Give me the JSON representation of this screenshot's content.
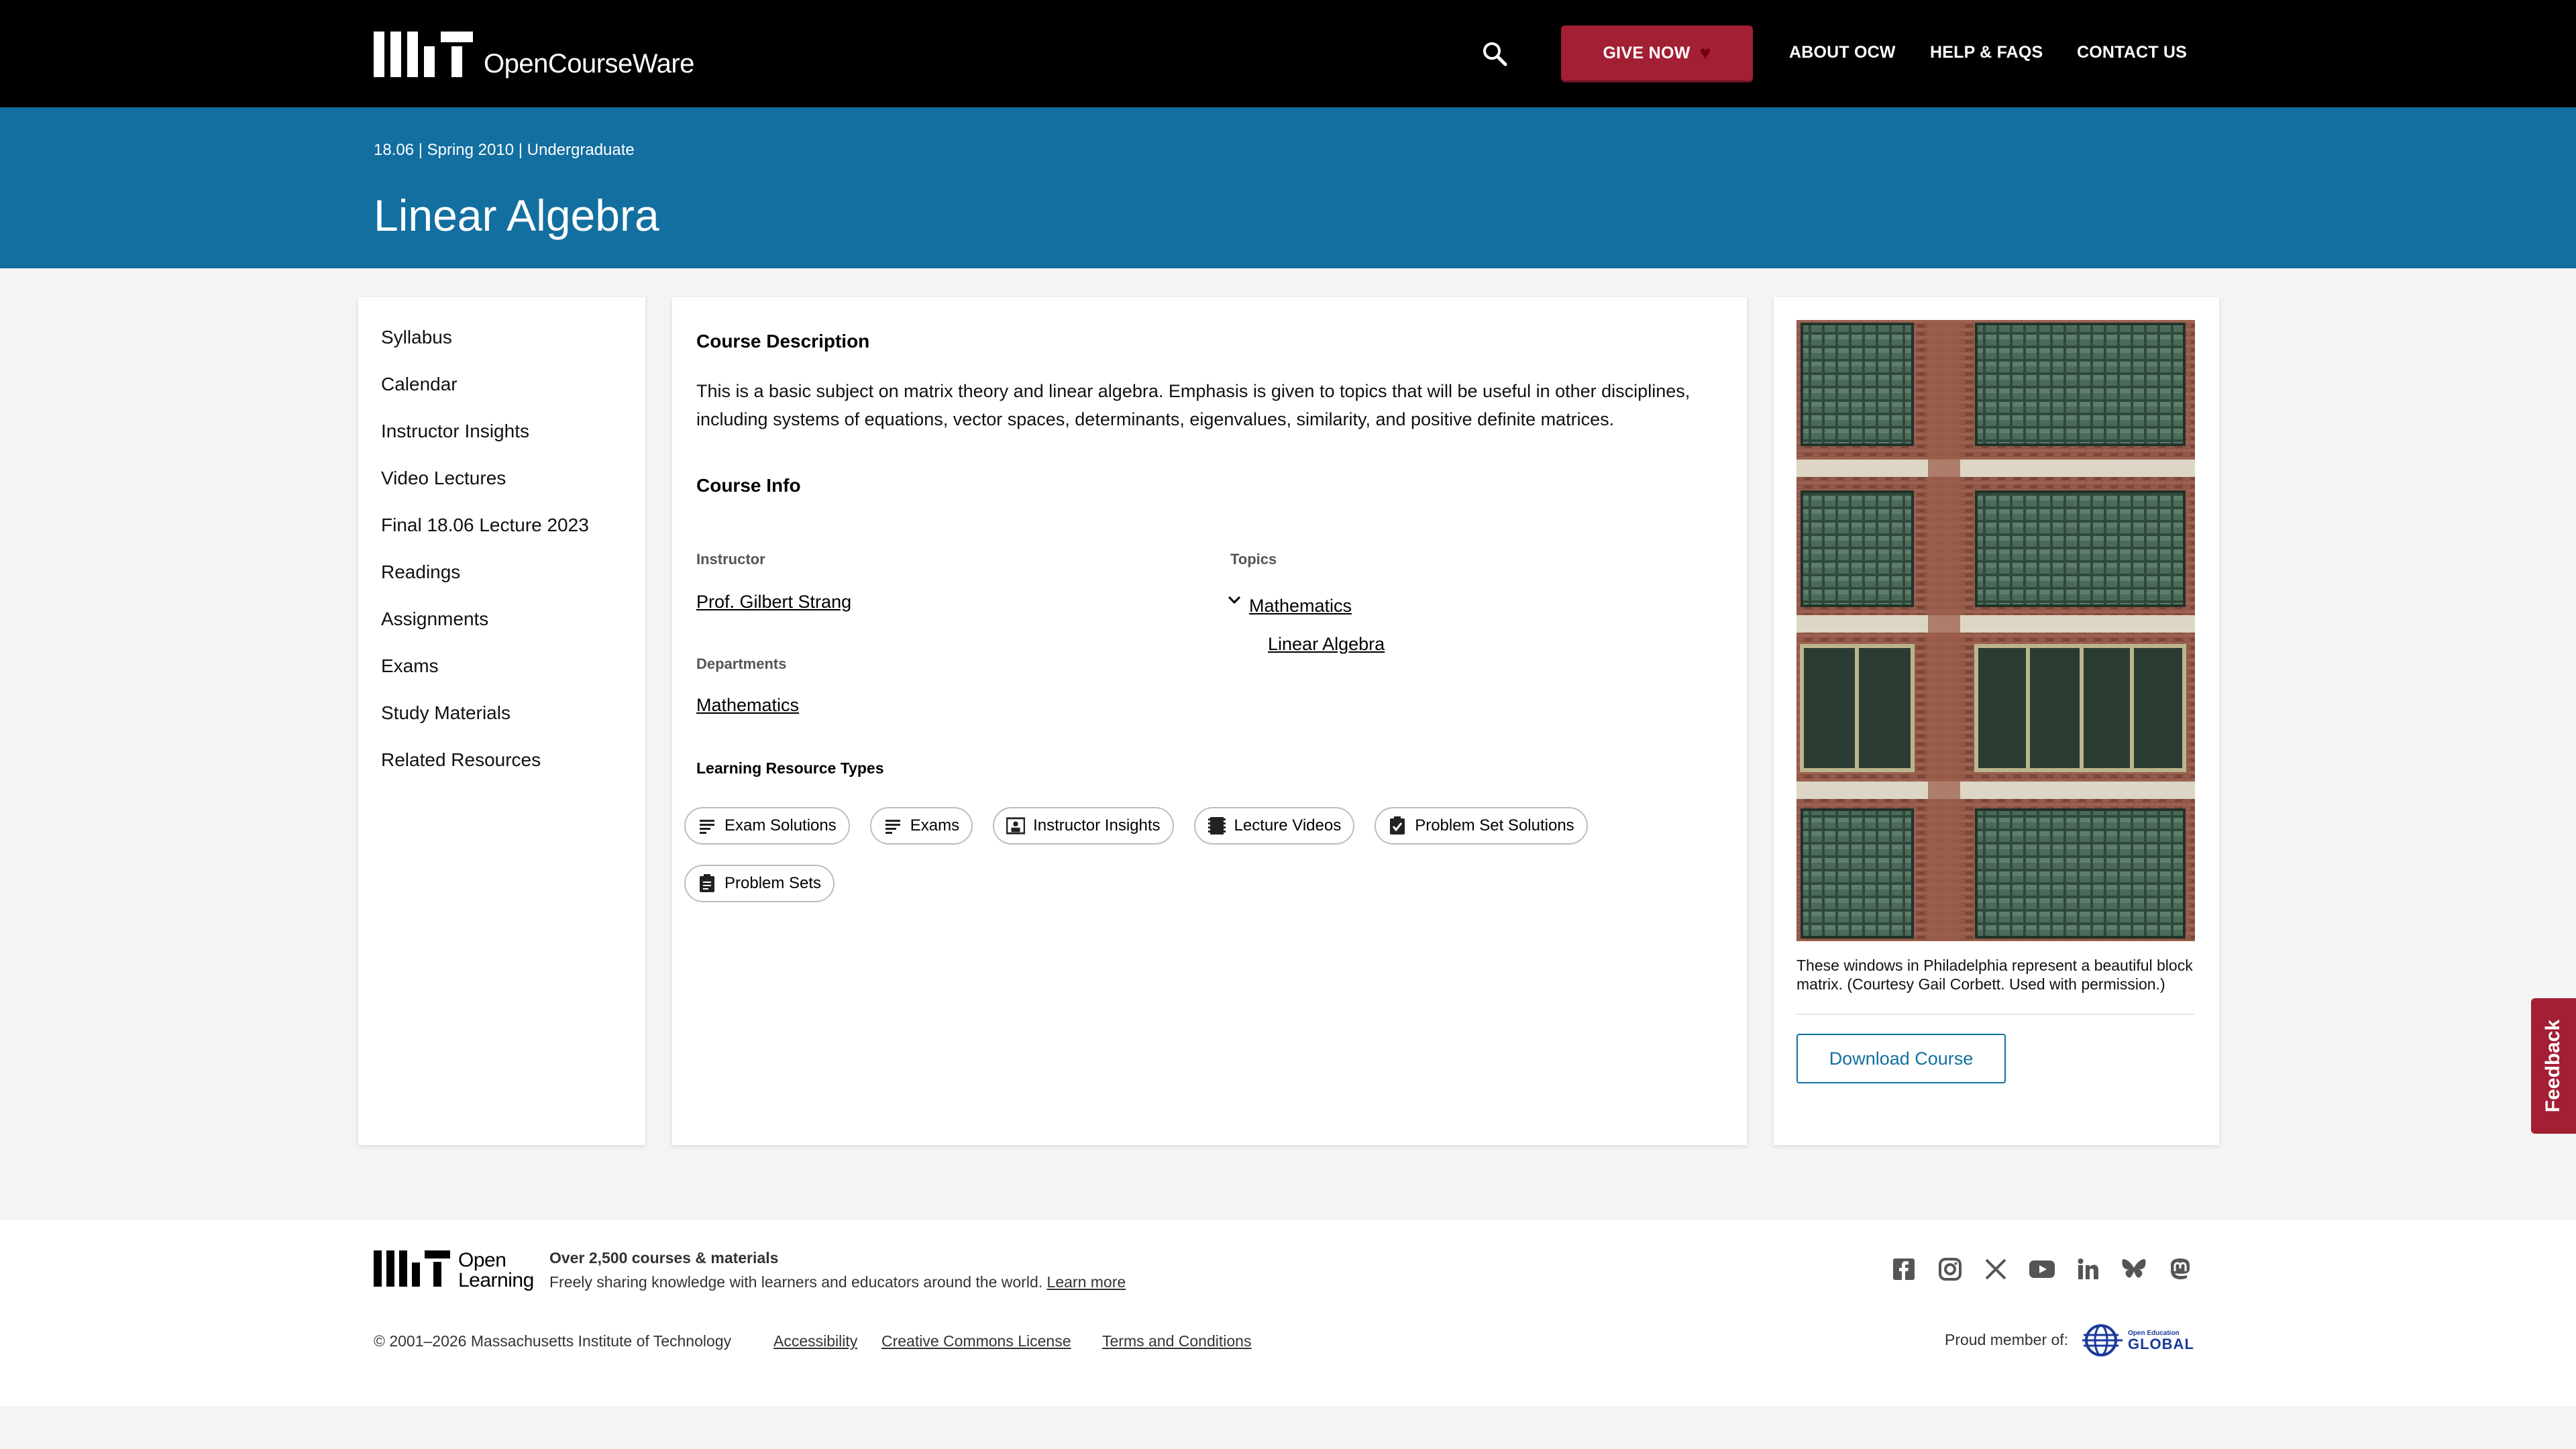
{
  "header": {
    "logo_text": "OpenCourseWare",
    "give_label": "GIVE NOW",
    "nav": [
      "ABOUT OCW",
      "HELP & FAQS",
      "CONTACT US"
    ]
  },
  "course": {
    "meta": "18.06 | Spring 2010 | Undergraduate",
    "title": "Linear Algebra"
  },
  "sidebar": {
    "items": [
      "Syllabus",
      "Calendar",
      "Instructor Insights",
      "Video Lectures",
      "Final 18.06 Lecture 2023",
      "Readings",
      "Assignments",
      "Exams",
      "Study Materials",
      "Related Resources"
    ]
  },
  "main": {
    "description_heading": "Course Description",
    "description": "This is a basic subject on matrix theory and linear algebra. Emphasis is given to topics that will be useful in other disciplines, including systems of equations, vector spaces, determinants, eigenvalues, similarity, and positive definite matrices.",
    "info_heading": "Course Info",
    "instructor_label": "Instructor",
    "instructor": "Prof. Gilbert Strang",
    "departments_label": "Departments",
    "department": "Mathematics",
    "topics_label": "Topics",
    "topic": "Mathematics",
    "subtopic": "Linear Algebra",
    "lrt_heading": "Learning Resource Types",
    "resource_types": [
      {
        "label": "Exam Solutions",
        "icon": "notes-icon"
      },
      {
        "label": "Exams",
        "icon": "notes-icon"
      },
      {
        "label": "Instructor Insights",
        "icon": "instructor-icon"
      },
      {
        "label": "Lecture Videos",
        "icon": "film-icon"
      },
      {
        "label": "Problem Set Solutions",
        "icon": "checked-clipboard-icon"
      },
      {
        "label": "Problem Sets",
        "icon": "clipboard-icon"
      }
    ]
  },
  "aside": {
    "caption": "These windows in Philadelphia represent a beautiful block matrix. (Courtesy Gail Corbett. Used with permission.)",
    "download_label": "Download Course"
  },
  "feedback_label": "Feedback",
  "footer": {
    "ol_text_1": "Open",
    "ol_text_2": "Learning",
    "headline": "Over 2,500 courses & materials",
    "tagline": "Freely sharing knowledge with learners and educators around the world.",
    "learn_more": "Learn more",
    "copyright": "© 2001–2026 Massachusetts Institute of Technology",
    "links": [
      "Accessibility",
      "Creative Commons License",
      "Terms and Conditions"
    ],
    "proud": "Proud member of:",
    "oeg_small_1": "Open Education",
    "oeg_big": "GLOBAL",
    "social": [
      "facebook-icon",
      "instagram-icon",
      "x-icon",
      "youtube-icon",
      "linkedin-icon",
      "bluesky-icon",
      "mastodon-icon"
    ]
  },
  "colors": {
    "header_bg": "#000000",
    "banner_bg": "#126fa0",
    "give_bg": "#a31f34",
    "page_bg": "#f4f4f5"
  }
}
